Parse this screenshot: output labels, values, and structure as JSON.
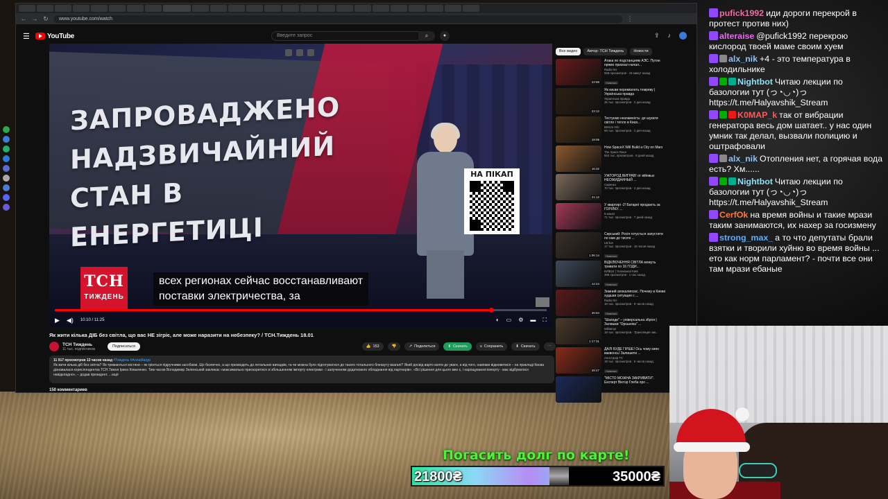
{
  "browser": {
    "url": "www.youtube.com/watch"
  },
  "youtube": {
    "logo": "YouTube",
    "search_placeholder": "Введите запрос"
  },
  "player": {
    "headline_lines": [
      "ЗАПРОВАДЖЕНО",
      "НАДЗВИЧАЙНИЙ",
      "СТАН В ЕНЕРГЕТИЦІ"
    ],
    "qr_label": "НА ПІКАП",
    "badge_big": "ТСН",
    "badge_small": "ТИЖДЕНЬ",
    "caption_line1": "всех регионах сейчас восстанавливают",
    "caption_line2": "поставки электричества, за",
    "time": "10:10 / 11:25",
    "progress_fraction": 0.887
  },
  "video": {
    "title": "Як жити кілька ДІБ без світла, що вас НЕ зігріє, але може наразити на небезпеку? / ТСН.Тиждень 18.01",
    "channel": "ТСН Тиждень",
    "subscribers": "11 тыс. подписчиков",
    "subscribe_label": "Подписаться",
    "likes": "153",
    "share_label": "Поделиться",
    "download_label": "Скачать",
    "save_label": "Сохранить",
    "download2_label": "Скачать",
    "stats": "11 917 просмотров  13 часов назад",
    "tags": "#Тиждень #АллаМазур",
    "description": "Як жити кілька діб без світла? Як тримаються містяни – як гріються підручними засобами. Що безпечно, а що призводить до летальних випадків, та чи можна було підготуватися до такого тотального блекауту взагалі? Який досвід варто взяти до уваги, а від чого, навпаки відмовитися – на прикладі Києва дізнавалася кореспондентка ТСН.Тижня Ірина Коваленко. Тим часом Володимир Зеленський закликає «максимально прискоритися зі збільшенням імпорту електрики - і залученням додаткового обладнання від партнерів». «Всі рішення для цього вже є, і нарощування імпорту - має відбуватися невідкладно», – додав президент. ...ещё",
    "comments_count": "150 комментариев"
  },
  "chips": [
    "Все видео",
    "Автор: ТСН Тиждень",
    "Новости"
  ],
  "recommendations": [
    {
      "title": "Атака по подстанциям АЭС. Путин прямо признал начал...",
      "channel": "Radio NV",
      "stats": "558 просмотров · 15 минут назад",
      "badge": "Новинка",
      "duration": "23:58",
      "color": "#6b1a1a"
    },
    {
      "title": "Як києви переміагють темряву | Українська правда",
      "channel": "Українська правда",
      "stats": "35 тыс. просмотров · 2 дня назад",
      "badge": "",
      "duration": "23:12",
      "color": "#2d2014"
    },
    {
      "title": "Тестуємо незламність: де шукати світло і тепло в Києв...",
      "channel": "BIHUS Info",
      "stats": "69 тыс. просмотров · 2 дня назад",
      "badge": "",
      "duration": "19:05",
      "color": "#4a3218"
    },
    {
      "title": "How SpaceX Will Build a City on Mars",
      "channel": "The Space Race",
      "stats": "553 тыс. просмотров · 8 дней назад",
      "badge": "",
      "duration": "16:32",
      "color": "#8a5a30"
    },
    {
      "title": "УЖГОРОД ВИГРАВ! от війнвых НЕОЖИДАННЫЙ ...",
      "channel": "Сиренко",
      "stats": "70 тыс. просмотров · 2 дня назад",
      "badge": "",
      "duration": "21:12",
      "color": "#7a6a5a"
    },
    {
      "title": "У квартирі -2! Батареї продають за ГОРІЛКУ. ...",
      "channel": "5 канал",
      "stats": "71 тыс. просмотров · 7 дней назад",
      "badge": "",
      "duration": "",
      "color": "#a53a5a"
    },
    {
      "title": "Сирський: Росія готується запустити по нам до тисячі ...",
      "channel": "LB live",
      "stats": "17 тыс. просмотров · 16 часов назад",
      "badge": "Новинка",
      "duration": "1:06:14",
      "color": "#3a3028"
    },
    {
      "title": "ВІДКЛЮЧЕННЯ СВІТЛА можуть тривати по 16 ГОДИ...",
      "channel": "КИЇВ24 | Телеканал Київ",
      "stats": "396 просмотров · 1 час назад",
      "badge": "Новинка",
      "duration": "12:24",
      "color": "#3e4a5a"
    },
    {
      "title": "Зимний апокалипсис. Почему в Киеве худшая ситуация с ...",
      "channel": "Radio NV",
      "stats": "18 тыс. просмотров · 9 часов назад",
      "badge": "Новинка",
      "duration": "26:04",
      "color": "#5a1a1a"
    },
    {
      "title": "\"Шахеди\" – універсальна зброя | Залишки \"Орєшніка\" ...",
      "channel": "Militarnyi",
      "stats": "18 тыс. просмотров · Трансляция зак...",
      "badge": "",
      "duration": "1:17:31",
      "color": "#4a3a2a"
    },
    {
      "title": "ДАЛІ БУДЕ ГІРШЕ! Ось чому киян ваквонсь! Залишити ...",
      "channel": "Апостроф TV",
      "stats": "19 тыс. просмотров · 5 часов назад",
      "badge": "Новинка",
      "duration": "28:47",
      "color": "#8a2a1a"
    },
    {
      "title": "\"МІСТО МОЖНА ЗАКРИВАТИ\". Експерт Віктор Глеба про ...",
      "channel": "",
      "stats": "",
      "badge": "",
      "duration": "",
      "color": "#1a2a5a"
    }
  ],
  "chat": [
    {
      "user": "pufick1992",
      "color": "#f06aa8",
      "text": "иди дороги перекрой в протест против них)",
      "badges": [
        "#9146ff"
      ]
    },
    {
      "user": "alteraise",
      "color": "#e86af0",
      "text": "@pufick1992 перекрою кислород твоей маме своим хуем",
      "badges": [
        "#9146ff"
      ]
    },
    {
      "user": "alx_nik",
      "color": "#8ec2f4",
      "text": "+4 - это температура в холодильнике",
      "badges": [
        "#9146ff",
        "#888888"
      ]
    },
    {
      "user": "Nightbot",
      "color": "#8ee0f4",
      "text": "Читаю лекции по базологии тут (っ◔◡◔)っ https://t.me/Halyavshik_Stream",
      "badges": [
        "#9146ff",
        "#00ad03",
        "#00ad8c"
      ]
    },
    {
      "user": "K0MAP_k",
      "color": "#ff5a5a",
      "text": "так от вибрации генератора весь дом шатает.. у нас один умник так делал, вызвали полицию и оштрафовали",
      "badges": [
        "#9146ff",
        "#00ad03",
        "#e91916"
      ]
    },
    {
      "user": "alx_nik",
      "color": "#8ec2f4",
      "text": "Отопления нет, а горячая вода есть? Хм......",
      "badges": [
        "#9146ff",
        "#888888"
      ]
    },
    {
      "user": "Nightbot",
      "color": "#8ee0f4",
      "text": "Читаю лекции по базологии тут (っ◔◡◔)っ https://t.me/Halyavshik_Stream",
      "badges": [
        "#9146ff",
        "#00ad03",
        "#00ad8c"
      ]
    },
    {
      "user": "CerfOk",
      "color": "#ff7a3a",
      "text": "на время войны и такие мрази таким занимаются, их нахер за госизмену",
      "badges": [
        "#9146ff"
      ]
    },
    {
      "user": "strong_max_",
      "color": "#5ab0ff",
      "text": "а то что депутаты брали взятки и творили хуйню во время войны ... ето как норм парламент? - почти все они там мрази ебаные",
      "badges": [
        "#9146ff"
      ]
    }
  ],
  "goal": {
    "title": "Погасить долг по карте!",
    "current": "21800₴",
    "target": "35000₴",
    "progress": 0.623
  }
}
